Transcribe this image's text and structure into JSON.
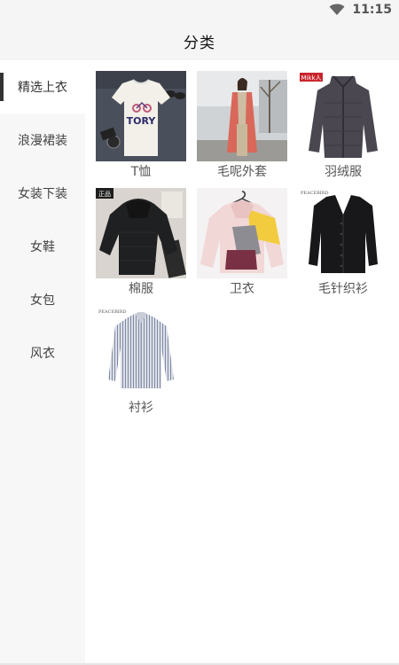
{
  "status_bar": {
    "time": "11:15",
    "icons": [
      "wifi-icon"
    ]
  },
  "header": {
    "title": "分类"
  },
  "sidebar": {
    "items": [
      {
        "label": "精选上衣",
        "active": true
      },
      {
        "label": "浪漫裙装",
        "active": false
      },
      {
        "label": "女装下装",
        "active": false
      },
      {
        "label": "女鞋",
        "active": false
      },
      {
        "label": "女包",
        "active": false
      },
      {
        "label": "风衣",
        "active": false
      }
    ]
  },
  "main": {
    "products": [
      {
        "label": "T恤",
        "icon": "tshirt-image"
      },
      {
        "label": "毛呢外套",
        "icon": "wool-coat-image"
      },
      {
        "label": "羽绒服",
        "icon": "down-jacket-image"
      },
      {
        "label": "棉服",
        "icon": "padded-jacket-image"
      },
      {
        "label": "卫衣",
        "icon": "hoodie-image"
      },
      {
        "label": "毛针织衫",
        "icon": "cardigan-image"
      },
      {
        "label": "衬衫",
        "icon": "shirt-image"
      }
    ],
    "image_logo_texts": {
      "tshirt": "TORY",
      "down_jacket_brand": "Mikk人",
      "padded_jacket_brand": "正品",
      "cardigan_brand": "PEACEBIRD",
      "shirt_brand": "PEACEBIRD"
    }
  },
  "colors": {
    "accent": "#333333",
    "sidebar_bg": "#f7f7f7",
    "appbar_bg": "#f5f5f5",
    "caption": "#555555"
  }
}
